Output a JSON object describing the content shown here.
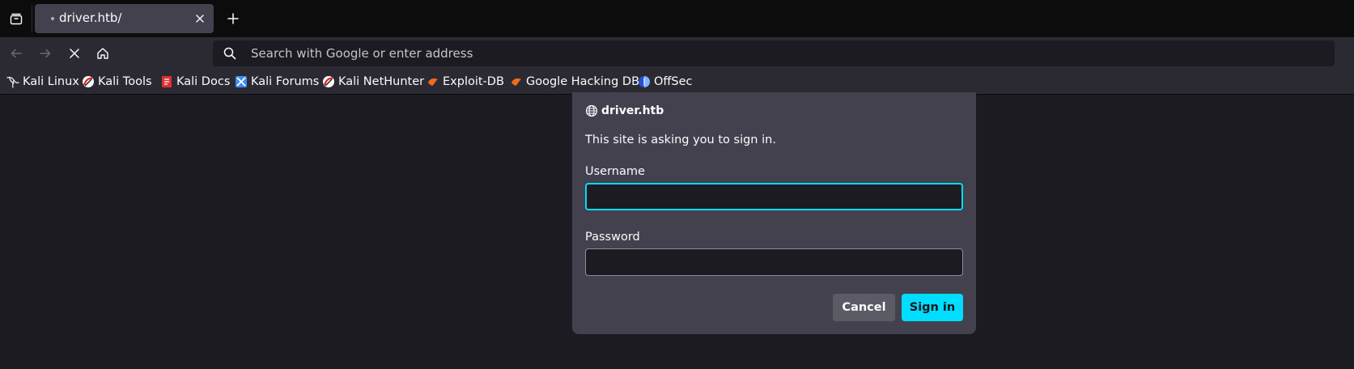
{
  "tabs": [
    {
      "title": "driver.htb/",
      "active": true
    }
  ],
  "navbar": {
    "url_placeholder": "Search with Google or enter address",
    "url_value": ""
  },
  "bookmarks": [
    {
      "label": "Kali Linux",
      "icon": "kali-dragon-icon"
    },
    {
      "label": "Kali Tools",
      "icon": "kali-tools-icon"
    },
    {
      "label": "Kali Docs",
      "icon": "kali-docs-icon"
    },
    {
      "label": "Kali Forums",
      "icon": "kali-forums-icon"
    },
    {
      "label": "Kali NetHunter",
      "icon": "kali-nethunter-icon"
    },
    {
      "label": "Exploit-DB",
      "icon": "exploit-db-icon"
    },
    {
      "label": "Google Hacking DB",
      "icon": "ghdb-icon"
    },
    {
      "label": "OffSec",
      "icon": "offsec-icon"
    }
  ],
  "dialog": {
    "host": "driver.htb",
    "message": "This site is asking you to sign in.",
    "username_label": "Username",
    "username_value": "",
    "password_label": "Password",
    "password_value": "",
    "cancel_label": "Cancel",
    "signin_label": "Sign in"
  },
  "colors": {
    "accent": "#00ddff",
    "toolbar": "#2b2a33",
    "tabstrip": "#0c0c0d",
    "content": "#1c1b22",
    "dialog": "#42414d"
  }
}
